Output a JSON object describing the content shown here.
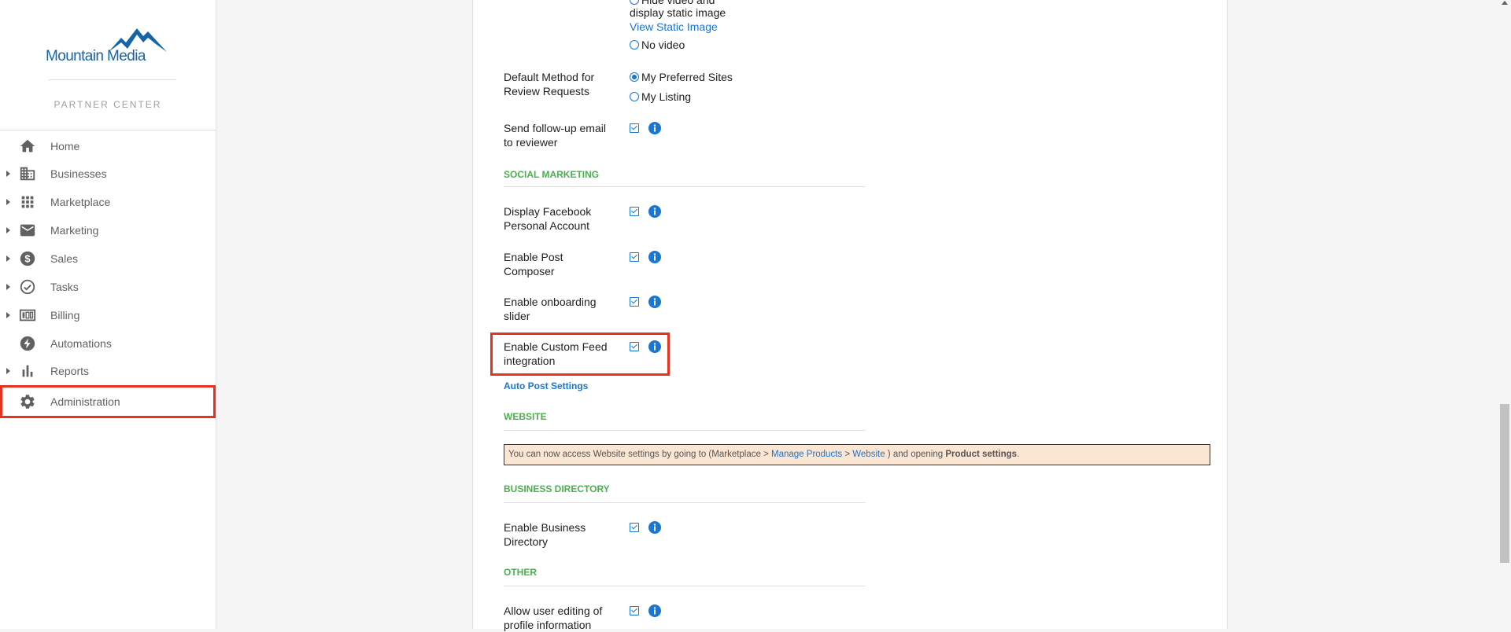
{
  "brand": {
    "logo_text": "Mountain Media",
    "subtitle": "PARTNER CENTER",
    "colors": {
      "accent": "#1976d2",
      "brand": "#1565a6",
      "section": "#4caf50",
      "highlight": "#e53322"
    }
  },
  "sidebar": {
    "items": [
      {
        "label": "Home",
        "icon": "home-icon",
        "expandable": false
      },
      {
        "label": "Businesses",
        "icon": "building-icon",
        "expandable": true
      },
      {
        "label": "Marketplace",
        "icon": "grid-icon",
        "expandable": true
      },
      {
        "label": "Marketing",
        "icon": "mail-icon",
        "expandable": true
      },
      {
        "label": "Sales",
        "icon": "dollar-icon",
        "expandable": true
      },
      {
        "label": "Tasks",
        "icon": "check-circle-icon",
        "expandable": true
      },
      {
        "label": "Billing",
        "icon": "billing-icon",
        "expandable": true
      },
      {
        "label": "Automations",
        "icon": "bolt-icon",
        "expandable": false
      },
      {
        "label": "Reports",
        "icon": "bar-chart-icon",
        "expandable": true
      },
      {
        "label": "Administration",
        "icon": "gear-icon",
        "expandable": false,
        "active": true
      }
    ]
  },
  "content": {
    "video_options": {
      "partial_option": "Hide video and",
      "partial_option_2": "display static image",
      "view_static_link": "View Static Image",
      "no_video": "No video"
    },
    "review_method": {
      "label": "Default Method for Review Requests",
      "options": [
        "My Preferred Sites",
        "My Listing"
      ],
      "selected": "My Preferred Sites"
    },
    "follow_up": {
      "label": "Send follow-up email to reviewer",
      "checked": true
    },
    "social_section": "SOCIAL MARKETING",
    "social_settings": [
      {
        "label": "Display Facebook Personal Account",
        "checked": true
      },
      {
        "label": "Enable Post Composer",
        "checked": true
      },
      {
        "label": "Enable onboarding slider",
        "checked": true
      },
      {
        "label": "Enable Custom Feed integration",
        "checked": true
      }
    ],
    "auto_post_link": "Auto Post Settings",
    "website_section": "WEBSITE",
    "website_notice": {
      "prefix": "You can now access Website settings by going to (Marketplace > ",
      "link1": "Manage Products",
      "sep": " > ",
      "link2": "Website",
      "middle": " ) and opening ",
      "bold": "Product settings",
      "suffix": "."
    },
    "directory_section": "BUSINESS DIRECTORY",
    "directory_setting": {
      "label": "Enable Business Directory",
      "checked": true
    },
    "other_section": "OTHER",
    "other_setting": {
      "label": "Allow user editing of profile information",
      "checked": true
    }
  }
}
